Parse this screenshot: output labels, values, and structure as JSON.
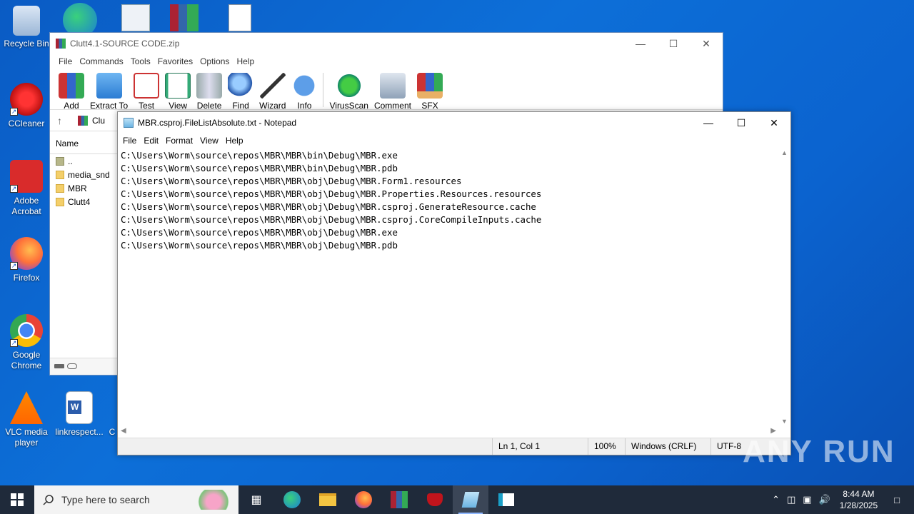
{
  "desktop": {
    "icons": [
      {
        "label": "Recycle Bin",
        "icon": "recycle-bin-icon"
      },
      {
        "label": "CCleaner",
        "icon": "ccleaner-icon"
      },
      {
        "label": "Adobe Acrobat",
        "icon": "adobe-acrobat-icon"
      },
      {
        "label": "Firefox",
        "icon": "firefox-icon"
      },
      {
        "label": "Google Chrome",
        "icon": "chrome-icon"
      },
      {
        "label": "VLC media player",
        "icon": "vlc-icon"
      },
      {
        "label": "linkrespect...",
        "icon": "word-doc-icon"
      },
      {
        "label": "C",
        "icon": "partial-icon"
      }
    ],
    "watermark": "ANY RUN"
  },
  "winrar": {
    "title": "Clutt4.1-SOURCE CODE.zip",
    "menu": [
      "File",
      "Commands",
      "Tools",
      "Favorites",
      "Options",
      "Help"
    ],
    "toolbar": [
      "Add",
      "Extract To",
      "Test",
      "View",
      "Delete",
      "Find",
      "Wizard",
      "Info",
      "VirusScan",
      "Comment",
      "SFX"
    ],
    "path_fragment": "Clu",
    "column_name": "Name",
    "files": [
      "..",
      "media_snd",
      "MBR",
      "Clutt4"
    ]
  },
  "notepad": {
    "title": "MBR.csproj.FileListAbsolute.txt - Notepad",
    "menu": [
      "File",
      "Edit",
      "Format",
      "View",
      "Help"
    ],
    "lines": [
      "C:\\Users\\Worm\\source\\repos\\MBR\\MBR\\bin\\Debug\\MBR.exe",
      "C:\\Users\\Worm\\source\\repos\\MBR\\MBR\\bin\\Debug\\MBR.pdb",
      "C:\\Users\\Worm\\source\\repos\\MBR\\MBR\\obj\\Debug\\MBR.Form1.resources",
      "C:\\Users\\Worm\\source\\repos\\MBR\\MBR\\obj\\Debug\\MBR.Properties.Resources.resources",
      "C:\\Users\\Worm\\source\\repos\\MBR\\MBR\\obj\\Debug\\MBR.csproj.GenerateResource.cache",
      "C:\\Users\\Worm\\source\\repos\\MBR\\MBR\\obj\\Debug\\MBR.csproj.CoreCompileInputs.cache",
      "C:\\Users\\Worm\\source\\repos\\MBR\\MBR\\obj\\Debug\\MBR.exe",
      "C:\\Users\\Worm\\source\\repos\\MBR\\MBR\\obj\\Debug\\MBR.pdb"
    ],
    "status": {
      "position": "Ln 1, Col 1",
      "zoom": "100%",
      "line_ending": "Windows (CRLF)",
      "encoding": "UTF-8"
    }
  },
  "taskbar": {
    "search_placeholder": "Type here to search",
    "time": "8:44 AM",
    "date": "1/28/2025"
  }
}
